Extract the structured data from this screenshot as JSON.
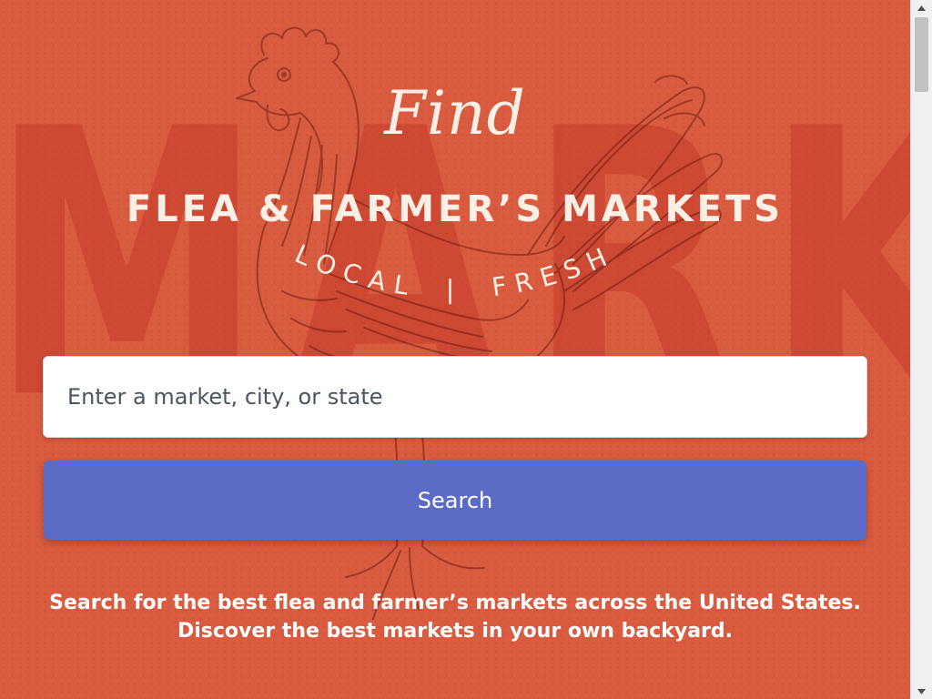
{
  "hero": {
    "find": "Find",
    "title": "FLEA & FARMER’S MARKETS",
    "subtitle_left": "LOCAL",
    "subtitle_sep": "|",
    "subtitle_right": "FRESH",
    "background_word": "MARKETS"
  },
  "search": {
    "placeholder": "Enter a market, city, or state",
    "value": "",
    "button_label": "Search"
  },
  "tagline": {
    "line1": "Search for the best flea and farmer’s markets across the United States.",
    "line2": "Discover the best markets in your own backyard."
  },
  "colors": {
    "background": "#d95c41",
    "button": "#5b6bc6",
    "text_light": "#fbefe6"
  },
  "icons": {
    "scroll_up": "scroll-up-arrow-icon",
    "scroll_down": "scroll-down-arrow-icon",
    "illustration": "rooster-icon"
  }
}
